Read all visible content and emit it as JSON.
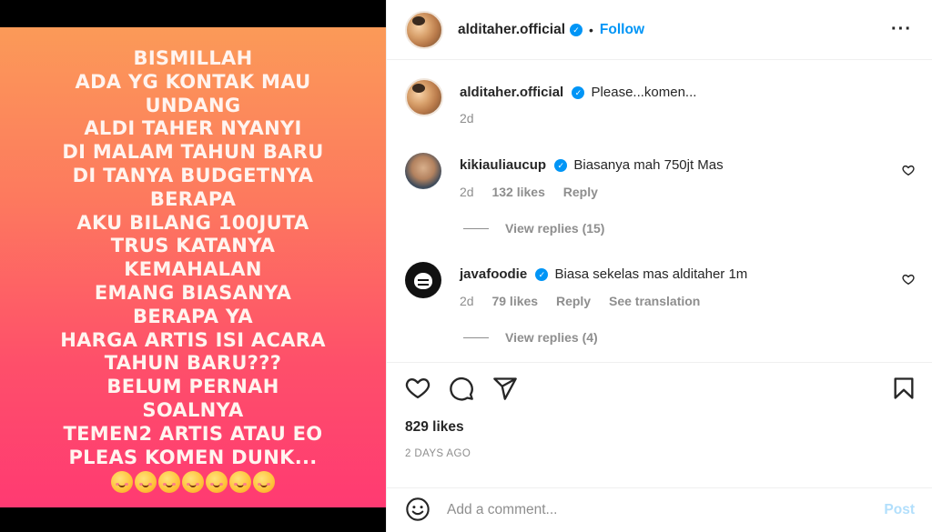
{
  "story": {
    "lines": [
      "BISMILLAH",
      "ADA YG KONTAK MAU",
      "UNDANG",
      "ALDI TAHER NYANYI",
      "DI MALAM TAHUN BARU",
      "DI TANYA BUDGETNYA",
      "BERAPA",
      "AKU BILANG 100JUTA",
      "TRUS KATANYA",
      "KEMAHALAN",
      "EMANG BIASANYA",
      "BERAPA YA",
      "HARGA ARTIS ISI ACARA",
      "TAHUN BARU???",
      "BELUM PERNAH",
      "SOALNYA",
      "TEMEN2 ARTIS ATAU EO",
      "PLEAS KOMEN DUNK..."
    ],
    "emoji_count": 7,
    "emoji_name": "smiling-face-with-hearts"
  },
  "header": {
    "username": "alditaher.official",
    "dot": "•",
    "follow_label": "Follow",
    "more_label": "•••"
  },
  "caption": {
    "username": "alditaher.official",
    "text": "Please...komen...",
    "time": "2d"
  },
  "comments": [
    {
      "username": "kikiauliaucup",
      "text": "Biasanya mah 750jt Mas",
      "time": "2d",
      "likes": "132 likes",
      "reply": "Reply",
      "view_replies": "View replies (15)"
    },
    {
      "username": "javafoodie",
      "text": "Biasa sekelas mas alditaher 1m",
      "time": "2d",
      "likes": "79 likes",
      "reply": "Reply",
      "translate": "See translation",
      "view_replies": "View replies (4)"
    }
  ],
  "actions": {
    "likes": "829 likes",
    "posted": "2 DAYS AGO"
  },
  "add_comment": {
    "placeholder": "Add a comment...",
    "post_label": "Post"
  },
  "colors": {
    "accent": "#0095f6",
    "muted": "#8e8e8e",
    "post_disabled": "#b2dffc"
  }
}
